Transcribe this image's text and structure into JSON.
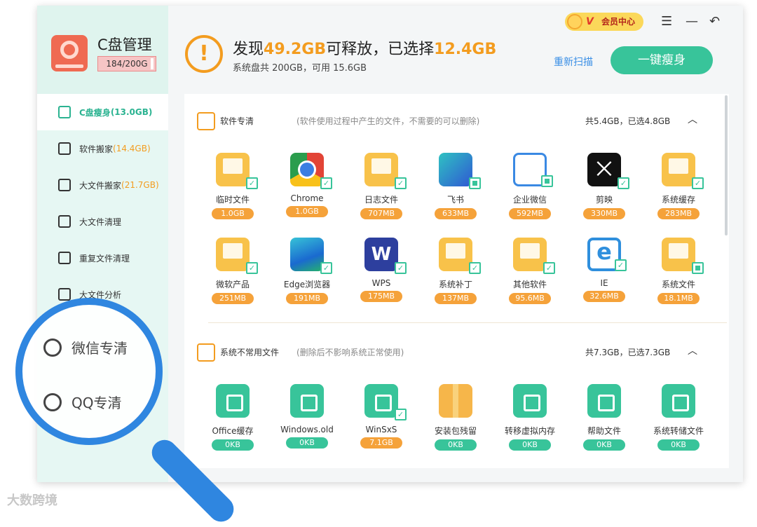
{
  "app": {
    "title": "C盘管理",
    "quota": "184/200G"
  },
  "nav": [
    {
      "label": "C盘瘦身",
      "value": "(13.0GB)",
      "icon": "broom-icon"
    },
    {
      "label": "软件搬家",
      "value": "(14.4GB)",
      "icon": "truck-icon"
    },
    {
      "label": "大文件搬家",
      "value": "(21.7GB)",
      "icon": "file-move-icon"
    },
    {
      "label": "大文件清理",
      "value": "",
      "icon": "clean-icon"
    },
    {
      "label": "重复文件清理",
      "value": "",
      "icon": "duplicate-icon"
    },
    {
      "label": "大文件分析",
      "value": "",
      "icon": "chart-icon"
    }
  ],
  "topbar": {
    "vip_label": "会员中心",
    "vip_v": "V",
    "menu_icon": "list-icon",
    "minimize_icon": "minimize-icon",
    "back_icon": "undo-icon"
  },
  "summary": {
    "prefix": "发现",
    "found": "49.2GB",
    "mid": "可释放，已选择",
    "selected": "12.4GB",
    "disk_info": "系统盘共 200GB，可用 15.6GB",
    "rescan": "重新扫描",
    "slim_button": "一键瘦身"
  },
  "sections": [
    {
      "title": "软件专清",
      "desc": "(软件使用过程中产生的文件，不需要的可以删除)",
      "total": "共5.4GB，已选4.8GB",
      "items": [
        {
          "name": "临时文件",
          "size": "1.0GB",
          "icon": "folder-icon",
          "check": "full"
        },
        {
          "name": "Chrome",
          "size": "1.0GB",
          "icon": "chrome-icon",
          "check": "full"
        },
        {
          "name": "日志文件",
          "size": "707MB",
          "icon": "folder-icon",
          "check": "full"
        },
        {
          "name": "飞书",
          "size": "633MB",
          "icon": "feishu-icon",
          "check": "part"
        },
        {
          "name": "企业微信",
          "size": "592MB",
          "icon": "wxwork-icon",
          "check": "part"
        },
        {
          "name": "剪映",
          "size": "330MB",
          "icon": "capcut-icon",
          "check": "full"
        },
        {
          "name": "系统缓存",
          "size": "283MB",
          "icon": "folder-icon",
          "check": "full"
        },
        {
          "name": "微软产品",
          "size": "251MB",
          "icon": "folder-icon",
          "check": "full"
        },
        {
          "name": "Edge浏览器",
          "size": "191MB",
          "icon": "edge-icon",
          "check": "full"
        },
        {
          "name": "WPS",
          "size": "175MB",
          "icon": "wps-icon",
          "check": "full"
        },
        {
          "name": "系统补丁",
          "size": "137MB",
          "icon": "folder-icon",
          "check": "full"
        },
        {
          "name": "其他软件",
          "size": "95.6MB",
          "icon": "folder-icon",
          "check": "full"
        },
        {
          "name": "IE",
          "size": "32.6MB",
          "icon": "ie-icon",
          "check": "full"
        },
        {
          "name": "系统文件",
          "size": "18.1MB",
          "icon": "folder-icon",
          "check": "part"
        }
      ]
    },
    {
      "title": "系统不常用文件",
      "desc": "(删除后不影响系统正常使用)",
      "total": "共7.3GB，已选7.3GB",
      "items": [
        {
          "name": "Office缓存",
          "size": "0KB",
          "icon": "office-icon",
          "check": "none"
        },
        {
          "name": "Windows.old",
          "size": "0KB",
          "icon": "windows-icon",
          "check": "none"
        },
        {
          "name": "WinSxS",
          "size": "7.1GB",
          "icon": "winsxs-icon",
          "check": "full"
        },
        {
          "name": "安装包残留",
          "size": "0KB",
          "icon": "package-icon",
          "check": "none"
        },
        {
          "name": "转移虚拟内存",
          "size": "0KB",
          "icon": "memory-icon",
          "check": "none"
        },
        {
          "name": "帮助文件",
          "size": "0KB",
          "icon": "help-icon",
          "check": "none"
        },
        {
          "name": "系统转储文件",
          "size": "0KB",
          "icon": "dump-icon",
          "check": "none"
        }
      ]
    }
  ],
  "magnifier": {
    "item1": "微信专清",
    "item2": "QQ专清"
  },
  "watermark": "大数跨境"
}
